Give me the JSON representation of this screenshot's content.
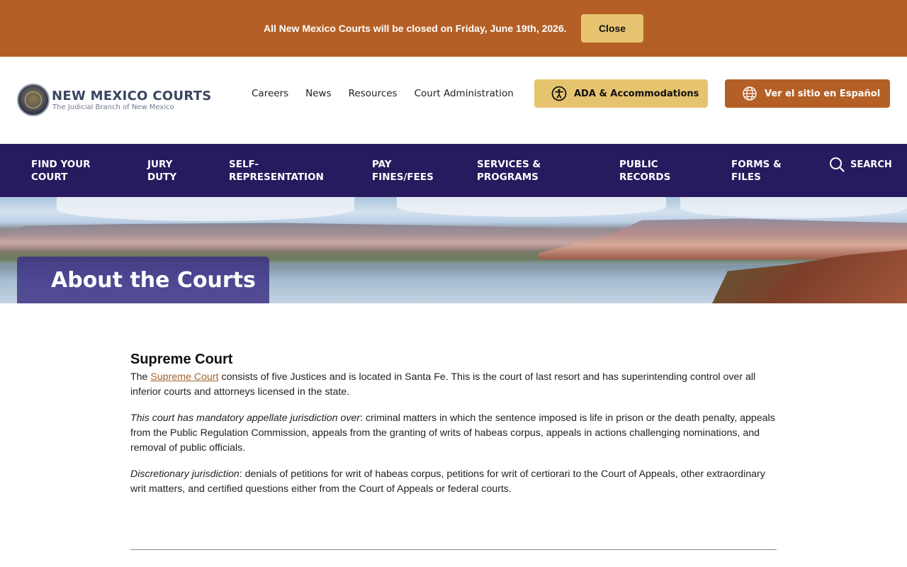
{
  "alert": {
    "message": "All New Mexico Courts will be closed on Friday, June 19th, 2026.",
    "close_label": "Close"
  },
  "header": {
    "logo_title": "NEW MEXICO COURTS",
    "logo_subtitle": "The Judicial Branch of New Mexico",
    "utility_links": [
      "Careers",
      "News",
      "Resources",
      "Court Administration"
    ],
    "ada_label": "ADA & Accommodations",
    "spanish_label": "Ver el sitio en Español"
  },
  "main_nav": {
    "items": [
      "FIND YOUR\nCOURT",
      "JURY\nDUTY",
      "SELF-\nREPRESENTATION",
      "PAY\nFINES/FEES",
      "SERVICES &\nPROGRAMS",
      "PUBLIC\nRECORDS",
      "FORMS &\nFILES"
    ],
    "search_label": "SEARCH"
  },
  "hero": {
    "title": "About the Courts"
  },
  "content": {
    "heading": "Supreme Court",
    "p1_before": "The ",
    "p1_link": "Supreme Court",
    "p1_after": " consists of five Justices and is located in Santa Fe. This is the court of last resort and has superintending control over all inferior courts and attorneys licensed in the state.",
    "p2_em": "This court has mandatory appellate jurisdiction over",
    "p2_rest": ": criminal matters in which the sentence imposed is life in prison or the death penalty, appeals from the Public Regulation Commission, appeals from the granting of writs of habeas corpus, appeals in actions challenging nominations, and removal of public officials.",
    "p3_em": "Discretionary jurisdiction",
    "p3_rest": ": denials of petitions for writ of habeas corpus, petitions for writ of certiorari to the Court of Appeals, other extraordinary writ matters, and certified questions either from the Court of Appeals or federal courts."
  },
  "colors": {
    "alert_bg": "#b45f26",
    "gold_button": "#e6c46f",
    "nav_bg": "#271a5e",
    "link": "#a0622a"
  },
  "icons": {
    "ada": "accessibility-icon",
    "spanish": "globe-icon",
    "search": "search-icon",
    "logo": "state-seal"
  }
}
